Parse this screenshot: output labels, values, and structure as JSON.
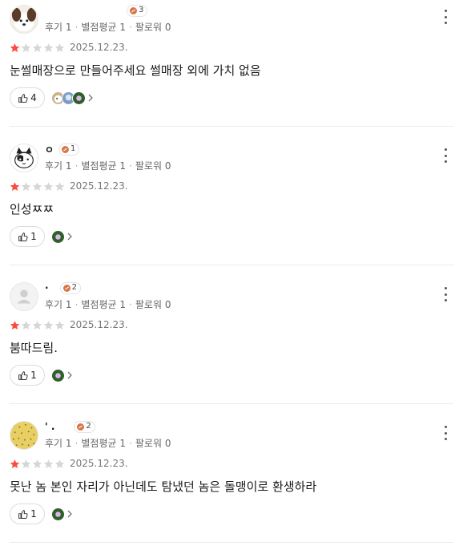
{
  "stats_labels": {
    "reviews": "후기",
    "average": "별점평균",
    "followers": "팔로워"
  },
  "reviews": [
    {
      "username": "",
      "level": "3",
      "review_count": "1",
      "avg_rating": "1",
      "followers": "0",
      "rating": 1,
      "date": "2025.12.23.",
      "text": "눈썰매장으로 만들어주세요 썰매장 외에 가치 없음",
      "likes": "4",
      "avatar": "dog-avatar-icon"
    },
    {
      "username": "ㅇ",
      "level": "1",
      "review_count": "1",
      "avg_rating": "1",
      "followers": "0",
      "rating": 1,
      "date": "2025.12.23.",
      "text": "인성ㅉㅉ",
      "likes": "1",
      "avatar": "cat-avatar-icon"
    },
    {
      "username": "·",
      "level": "2",
      "review_count": "1",
      "avg_rating": "1",
      "followers": "0",
      "rating": 1,
      "date": "2025.12.23.",
      "text": "붐따드림.",
      "likes": "1",
      "avatar": "default-avatar-icon"
    },
    {
      "username": "' .",
      "level": "2",
      "review_count": "1",
      "avg_rating": "1",
      "followers": "0",
      "rating": 1,
      "date": "2025.12.23.",
      "text": "못난 놈 본인 자리가 아닌데도 탐냈던 놈은 돌맹이로 환생하라",
      "likes": "1",
      "avatar": "pattern-avatar-icon"
    }
  ],
  "colors": {
    "star_filled": "#ff4a3d",
    "star_empty": "#d6d6d6",
    "divider": "#ebebeb"
  }
}
